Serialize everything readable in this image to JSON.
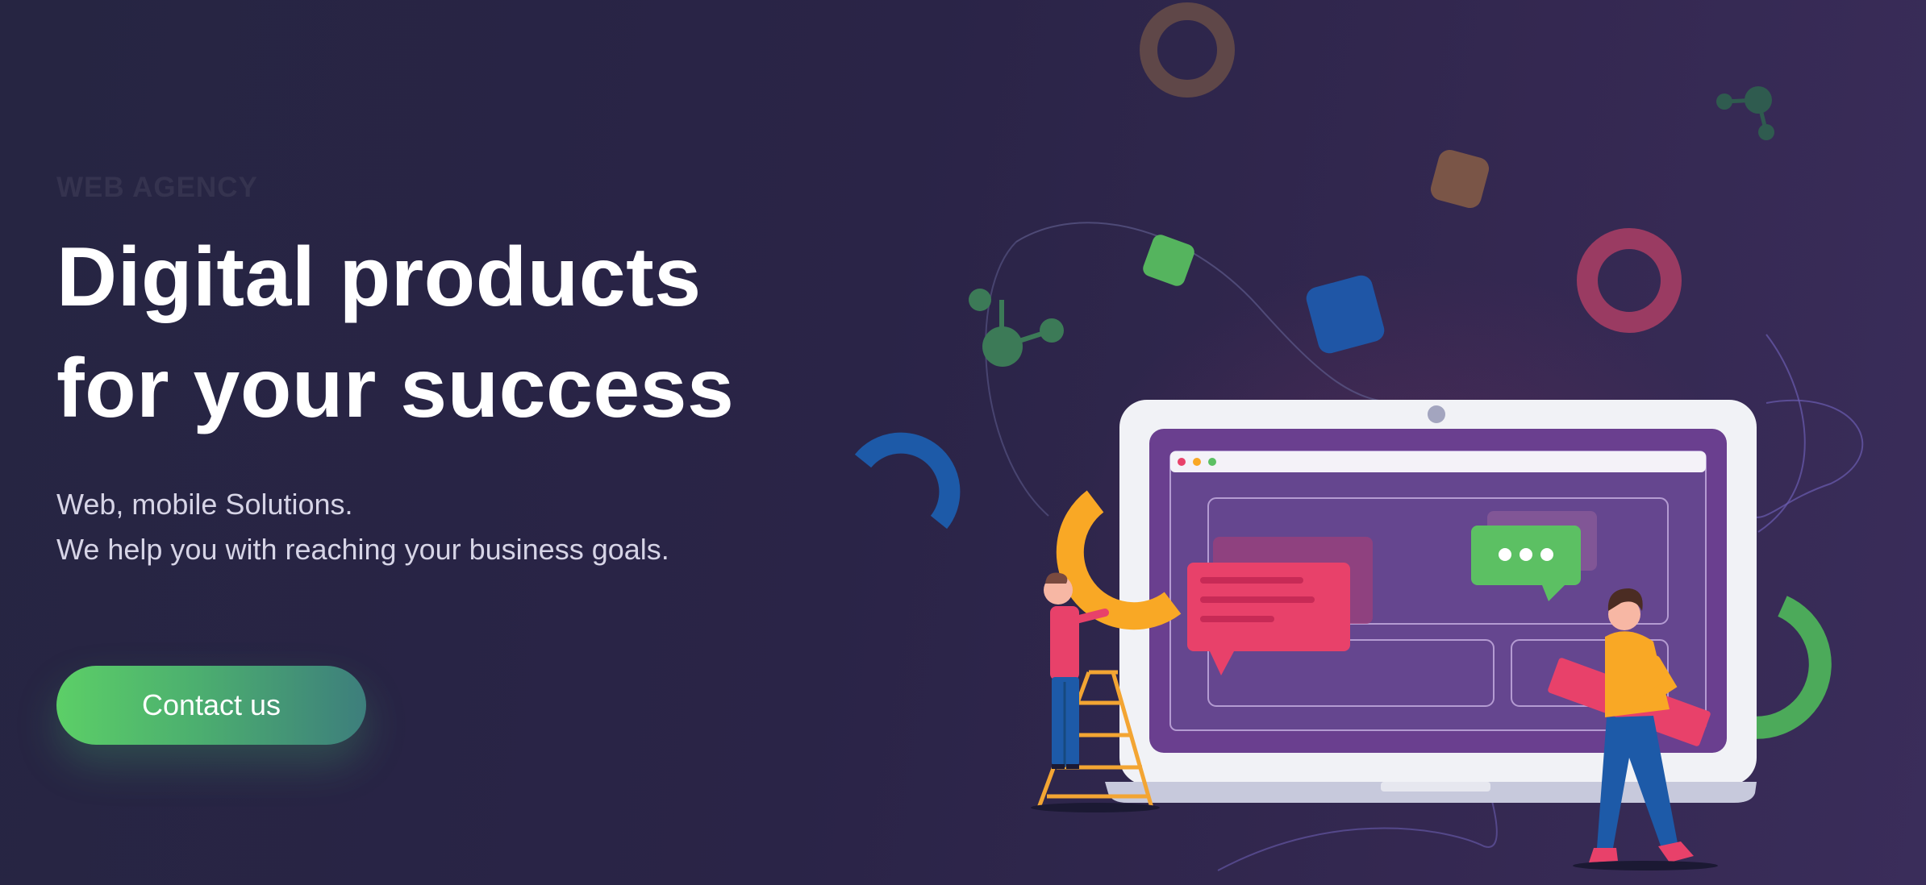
{
  "hero": {
    "eyebrow": "WEB AGENCY",
    "headline_line1": "Digital products",
    "headline_line2": "for your success",
    "subtitle_line1": "Web, mobile Solutions.",
    "subtitle_line2": "We help you with reaching your business goals.",
    "cta_label": "Contact us"
  },
  "colors": {
    "background": "#2a2447",
    "cta_start": "#5ccf67",
    "cta_end": "#3d7e7c",
    "laptop_screen": "#6a3f8f",
    "accent_pink": "#e8416a",
    "accent_yellow": "#f9a825",
    "accent_green": "#5cc063",
    "accent_blue": "#1d5aa8"
  },
  "illustration": {
    "icons": [
      "ring-icon",
      "rounded-square-icon",
      "molecule-icon",
      "arc-icon",
      "laptop-icon",
      "chat-bubble-icon",
      "ladder-icon",
      "person-icon"
    ]
  }
}
